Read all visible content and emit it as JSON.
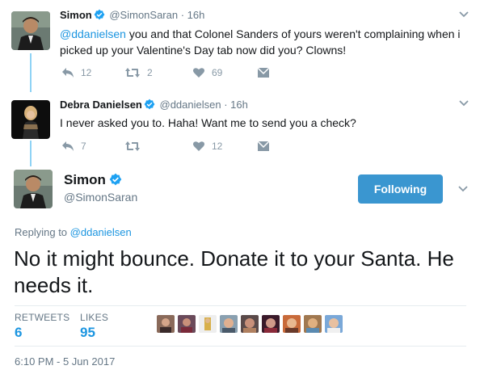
{
  "tweets": [
    {
      "name": "Simon",
      "handle": "@SimonSaran",
      "time": "· 16h",
      "mention": "@ddanielsen",
      "text": " you and that Colonel Sanders of yours weren't complaining when i picked up your Valentine's Day tab now did you? Clowns!",
      "replies": "12",
      "retweets": "2",
      "likes": "69"
    },
    {
      "name": "Debra Danielsen",
      "handle": "@ddanielsen",
      "time": "· 16h",
      "text": "I never asked you to.  Haha! Want me to send you a check?",
      "replies": "7",
      "retweets": "",
      "likes": "12"
    }
  ],
  "main": {
    "name": "Simon",
    "handle": "@SimonSaran",
    "follow_label": "Following",
    "replying_prefix": "Replying to ",
    "replying_to": "@ddanielsen",
    "text": "No it might bounce. Donate it to your Santa. He needs it.",
    "retweets_label": "RETWEETS",
    "retweets": "6",
    "likes_label": "LIKES",
    "likes": "95",
    "timestamp": "6:10 PM - 5 Jun 2017"
  },
  "colors": {
    "accent": "#1b95e0",
    "follow_button": "#3a96d0",
    "thread_line": "#8fd3f5",
    "muted": "#657786"
  },
  "icons": [
    "reply-icon",
    "retweet-icon",
    "heart-icon",
    "dm-icon",
    "verified-icon",
    "chevron-down-icon"
  ]
}
